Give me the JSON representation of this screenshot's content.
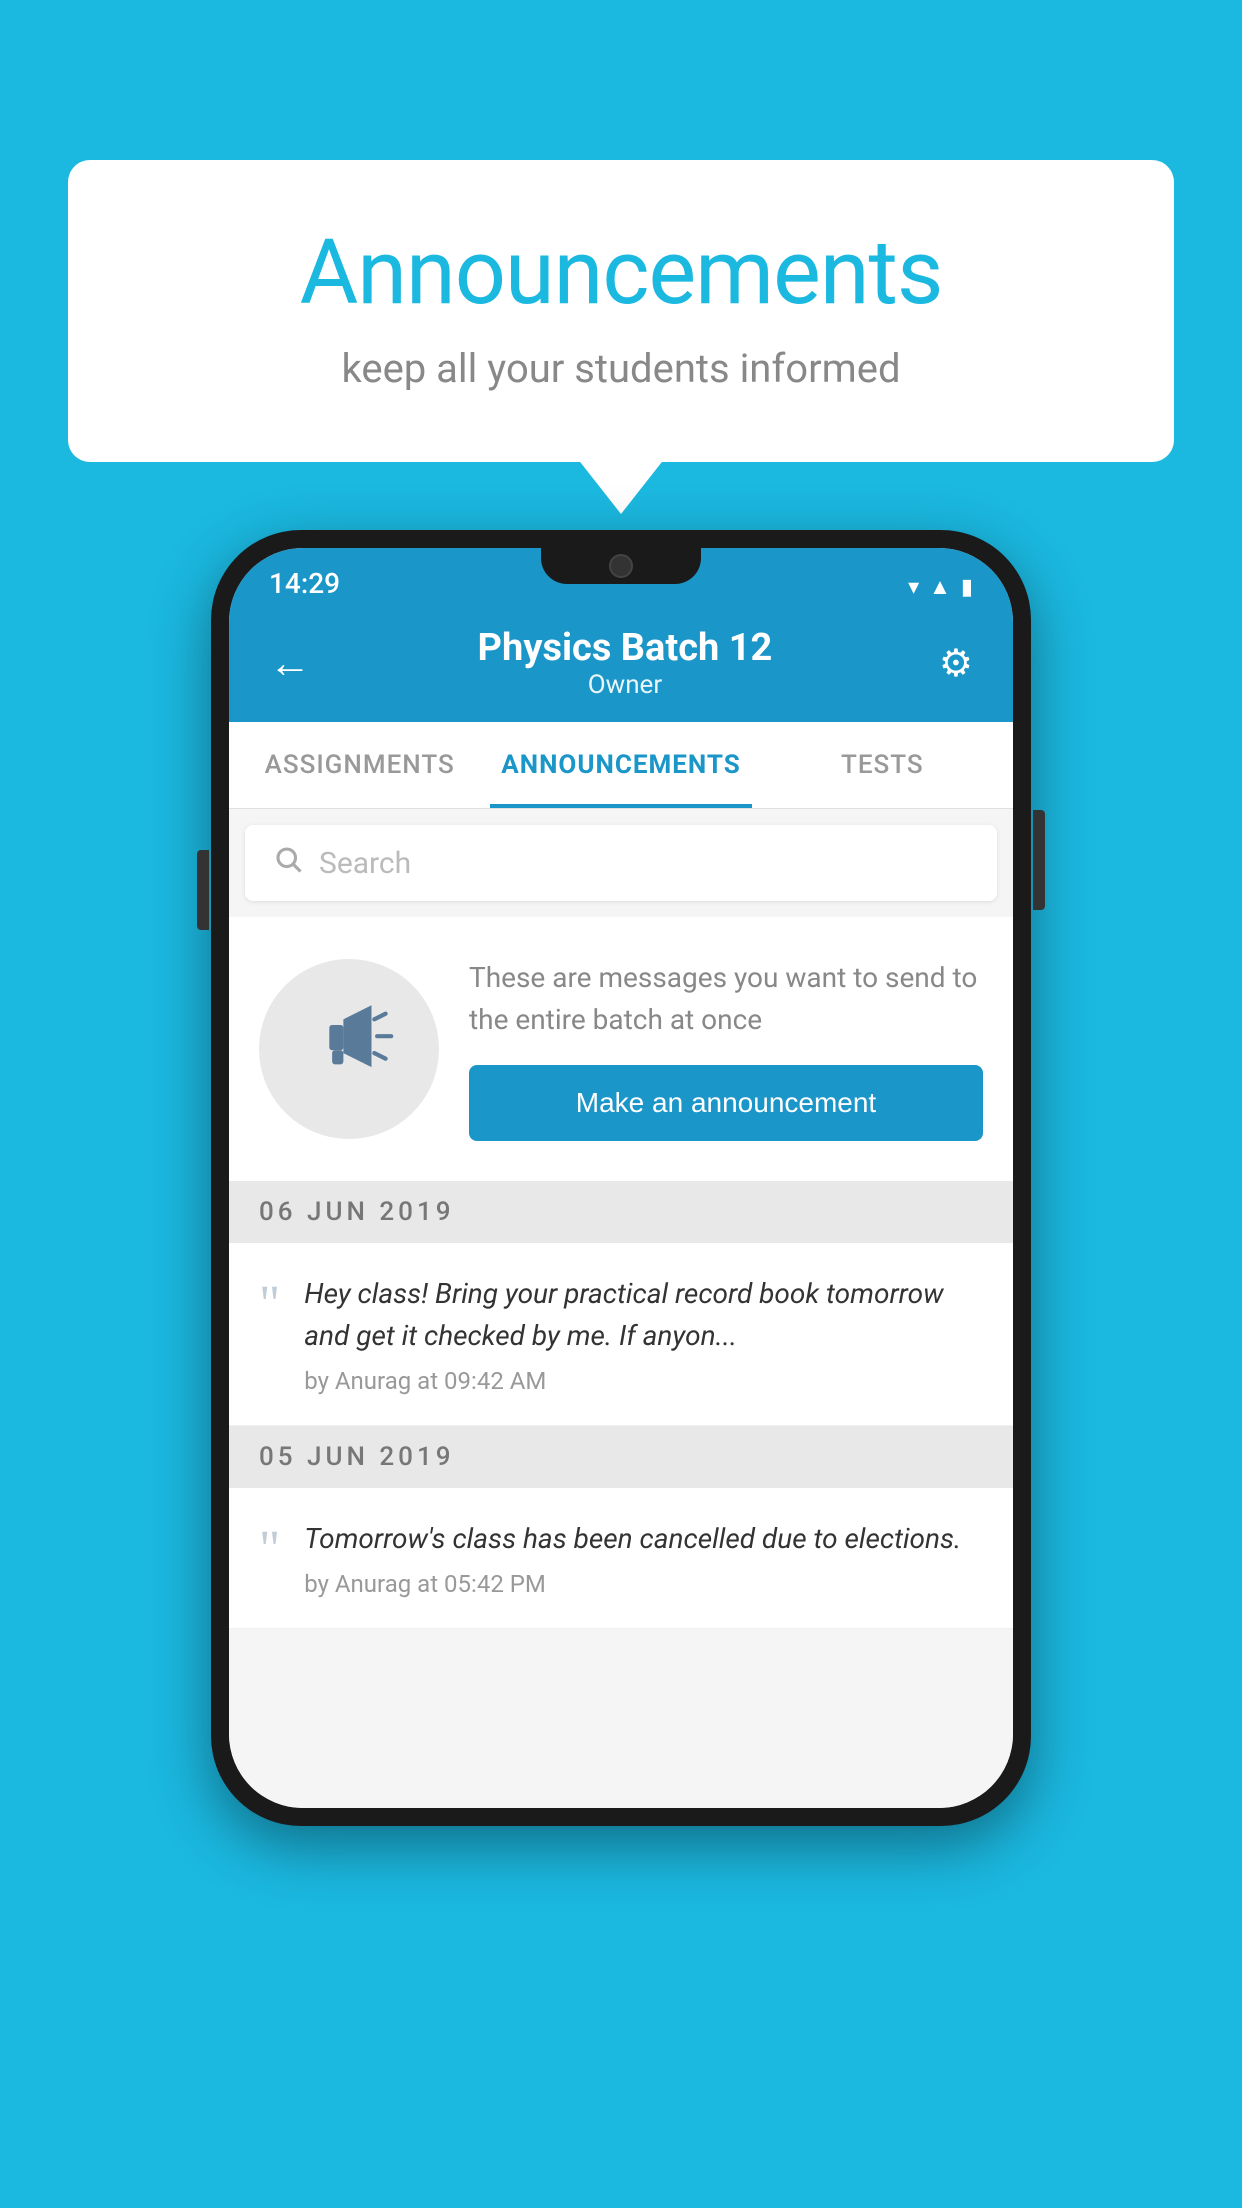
{
  "background_color": "#1bb8e0",
  "speech_bubble": {
    "title": "Announcements",
    "subtitle": "keep all your students informed"
  },
  "phone": {
    "status_bar": {
      "time": "14:29"
    },
    "header": {
      "title": "Physics Batch 12",
      "subtitle": "Owner",
      "back_label": "←",
      "settings_label": "⚙"
    },
    "tabs": [
      {
        "label": "ASSIGNMENTS",
        "active": false
      },
      {
        "label": "ANNOUNCEMENTS",
        "active": true
      },
      {
        "label": "TESTS",
        "active": false
      }
    ],
    "search": {
      "placeholder": "Search"
    },
    "promo": {
      "description": "These are messages you want to send to the entire batch at once",
      "button_label": "Make an announcement"
    },
    "announcements": [
      {
        "date": "06  JUN  2019",
        "items": [
          {
            "message": "Hey class! Bring your practical record book tomorrow and get it checked by me. If anyon...",
            "meta": "by Anurag at 09:42 AM"
          }
        ]
      },
      {
        "date": "05  JUN  2019",
        "items": [
          {
            "message": "Tomorrow's class has been cancelled due to elections.",
            "meta": "by Anurag at 05:42 PM"
          }
        ]
      }
    ]
  }
}
